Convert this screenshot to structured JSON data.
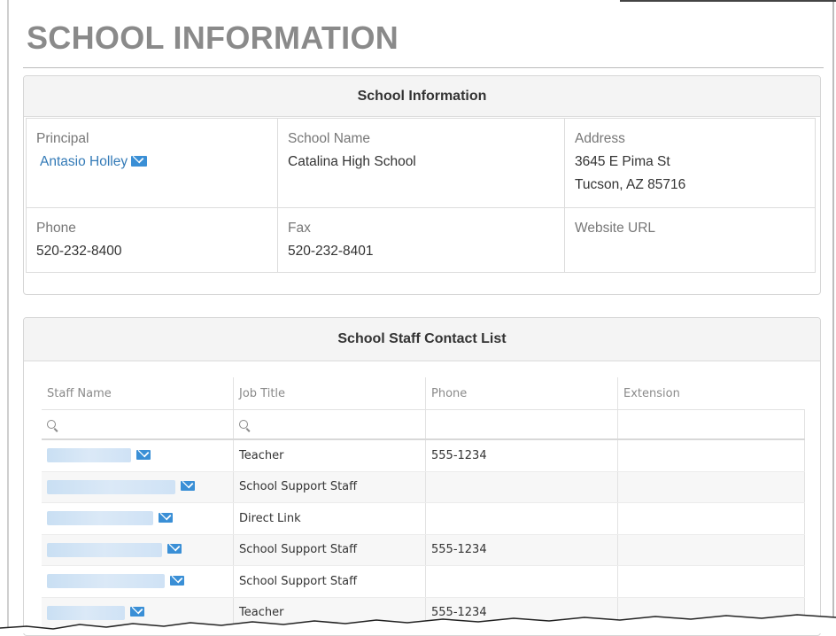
{
  "page_title": "SCHOOL INFORMATION",
  "info": {
    "heading": "School Information",
    "principal_label": "Principal",
    "principal_name": "Antasio Holley",
    "school_name_label": "School Name",
    "school_name": "Catalina High School",
    "address_label": "Address",
    "address_line1": "3645 E Pima St",
    "address_line2": "Tucson, AZ 85716",
    "phone_label": "Phone",
    "phone": "520-232-8400",
    "fax_label": "Fax",
    "fax": "520-232-8401",
    "website_label": "Website URL",
    "website": ""
  },
  "staff": {
    "heading": "School Staff Contact List",
    "columns": [
      "Staff Name",
      "Job Title",
      "Phone",
      "Extension"
    ],
    "rows": [
      {
        "name_blur": 95,
        "job_title": "Teacher",
        "phone": "555-1234",
        "extension": ""
      },
      {
        "name_blur": 145,
        "job_title": "School Support Staff",
        "phone": "",
        "extension": ""
      },
      {
        "name_blur": 120,
        "job_title": "Direct Link",
        "phone": "",
        "extension": ""
      },
      {
        "name_blur": 130,
        "job_title": "School Support Staff",
        "phone": "555-1234",
        "extension": ""
      },
      {
        "name_blur": 133,
        "job_title": "School Support Staff",
        "phone": "",
        "extension": ""
      },
      {
        "name_blur": 88,
        "job_title": "Teacher",
        "phone": "555-1234",
        "extension": ""
      }
    ]
  },
  "colors": {
    "link": "#337ab7",
    "mail_icon": "#3a8fd6",
    "title_gray": "#8a8a8a"
  }
}
